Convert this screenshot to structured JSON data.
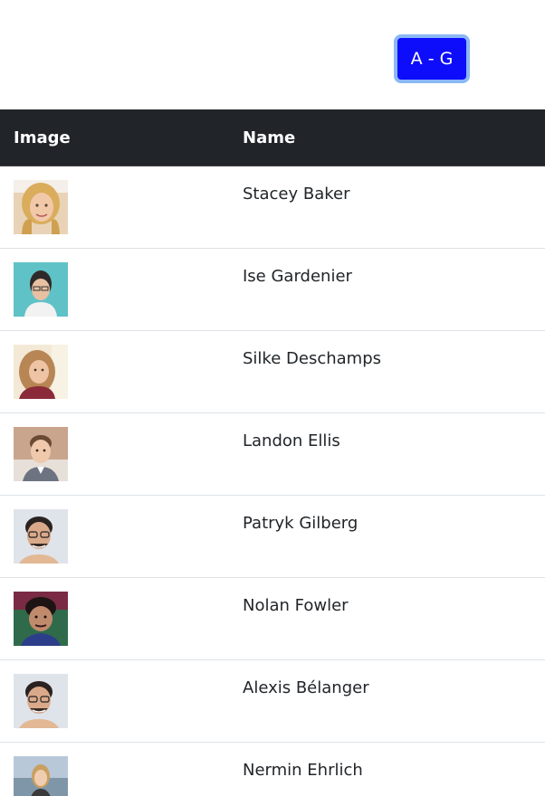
{
  "filter": {
    "label": "A - G"
  },
  "table": {
    "headers": {
      "image": "Image",
      "name": "Name"
    },
    "rows": [
      {
        "name": "Stacey Baker",
        "avatar": "woman-blonde-smiling-avatar"
      },
      {
        "name": "Ise Gardenier",
        "avatar": "woman-dark-hair-glasses-avatar"
      },
      {
        "name": "Silke Deschamps",
        "avatar": "woman-curly-hair-avatar"
      },
      {
        "name": "Landon Ellis",
        "avatar": "man-short-hair-avatar"
      },
      {
        "name": "Patryk Gilberg",
        "avatar": "man-glasses-avatar"
      },
      {
        "name": "Nolan Fowler",
        "avatar": "man-dark-hair-avatar"
      },
      {
        "name": "Alexis Bélanger",
        "avatar": "man-glasses-avatar"
      },
      {
        "name": "Nermin Ehrlich",
        "avatar": "woman-outdoor-avatar"
      }
    ]
  },
  "colors": {
    "button_bg": "#0d0dfb",
    "button_border": "#8ab8f4",
    "header_bg": "#212529",
    "row_border": "#dee2e6",
    "text": "#212529"
  }
}
